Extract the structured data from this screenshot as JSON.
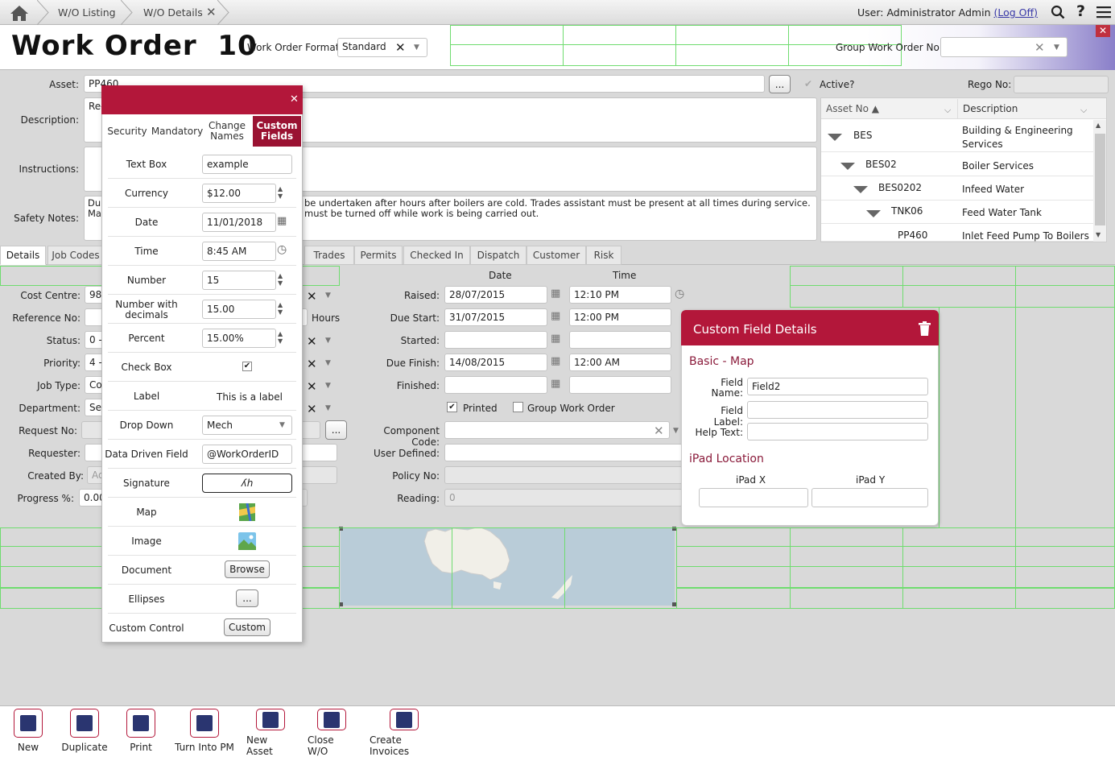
{
  "breadcrumbs": [
    "W/O Listing",
    "W/O Details"
  ],
  "user": {
    "prefix": "User: Administrator Admin",
    "logoff": "(Log Off)"
  },
  "title": "Work Order  10",
  "format": {
    "label": "Work Order Format",
    "value": "Standard"
  },
  "group_wo": {
    "label": "Group Work Order No:",
    "value": ""
  },
  "asset": {
    "label": "Asset:",
    "value": "PP460",
    "active_label": "Active?",
    "rego_label": "Rego No:"
  },
  "description": {
    "label": "Description:",
    "value": "Re-"
  },
  "instructions": {
    "label": "Instructions:"
  },
  "safety": {
    "label": "Safety Notes:",
    "line1a": "Du",
    "line2a": "Ma",
    "line1b": "be undertaken after hours after boilers are cold.  Trades assistant must be present at all times during service.",
    "line2b": "must be turned off while work is being carried out."
  },
  "tree": {
    "col1": "Asset No ▲",
    "col2": "Description",
    "rows": [
      {
        "no": "BES",
        "desc": "Building & Engineering Services"
      },
      {
        "no": "BES02",
        "desc": "Boiler Services"
      },
      {
        "no": "BES0202",
        "desc": "Infeed Water"
      },
      {
        "no": "TNK06",
        "desc": "Feed Water Tank"
      },
      {
        "no": "PP460",
        "desc": "Inlet Feed Pump To Boilers"
      }
    ]
  },
  "tabs": [
    "Details",
    "Job Codes",
    "Trades",
    "Permits",
    "Checked In",
    "Dispatch",
    "Customer",
    "Risk"
  ],
  "left_fields": [
    {
      "label": "Cost Centre:",
      "value": "98"
    },
    {
      "label": "Reference No:",
      "value": ""
    },
    {
      "label": "Status:",
      "value": "0 -"
    },
    {
      "label": "Priority:",
      "value": "4 -"
    },
    {
      "label": "Job Type:",
      "value": "Co"
    },
    {
      "label": "Department:",
      "value": "Se"
    },
    {
      "label": "Request No:",
      "value": ""
    },
    {
      "label": "Requester:",
      "value": ""
    },
    {
      "label": "Created By:",
      "value": "Ad"
    },
    {
      "label": "Progress %:",
      "value": "0.00"
    }
  ],
  "hours_label": "Hours",
  "dates": {
    "date_header": "Date",
    "time_header": "Time",
    "rows": [
      {
        "label": "Raised:",
        "date": "28/07/2015",
        "time": "12:10 PM"
      },
      {
        "label": "Due Start:",
        "date": "31/07/2015",
        "time": "12:00 PM"
      },
      {
        "label": "Started:",
        "date": "",
        "time": ""
      },
      {
        "label": "Due Finish:",
        "date": "14/08/2015",
        "time": "12:00 AM"
      },
      {
        "label": "Finished:",
        "date": "",
        "time": ""
      }
    ]
  },
  "printed_label": "Printed",
  "group_wo_label": "Group Work Order",
  "component_code": "Component Code:",
  "user_defined": "User Defined:",
  "policy_no": "Policy No:",
  "reading": {
    "label": "Reading:",
    "value": "0"
  },
  "popup": {
    "tabs": [
      "Security",
      "Mandatory",
      "Change Names",
      "Custom Fields"
    ],
    "rows": [
      {
        "label": "Text Box",
        "value": "example"
      },
      {
        "label": "Currency",
        "value": "$12.00"
      },
      {
        "label": "Date",
        "value": "11/01/2018"
      },
      {
        "label": "Time",
        "value": "8:45 AM"
      },
      {
        "label": "Number",
        "value": "15"
      },
      {
        "label": "Number with decimals",
        "value": "15.00"
      },
      {
        "label": "Percent",
        "value": "15.00%"
      },
      {
        "label": "Check Box",
        "value": ""
      },
      {
        "label": "Label",
        "value": "This is a label"
      },
      {
        "label": "Drop Down",
        "value": "Mech"
      },
      {
        "label": "Data Driven Field",
        "value": "@WorkOrderID"
      },
      {
        "label": "Signature",
        "value": ""
      },
      {
        "label": "Map",
        "value": ""
      },
      {
        "label": "Image",
        "value": ""
      },
      {
        "label": "Document",
        "value": "Browse"
      },
      {
        "label": "Ellipses",
        "value": "..."
      },
      {
        "label": "Custom Control",
        "value": "Custom"
      }
    ]
  },
  "cfd": {
    "title": "Custom Field Details",
    "section1": "Basic - Map",
    "field_name_label": "Field Name:",
    "field_name": "Field2",
    "field_label_label": "Field Label:",
    "help_text_label": "Help Text:",
    "section2": "iPad Location",
    "ipad_x": "iPad X",
    "ipad_y": "iPad Y"
  },
  "footer": [
    "New",
    "Duplicate",
    "Print",
    "Turn Into PM",
    "New Asset",
    "Close W/O",
    "Create Invoices"
  ],
  "colors": {
    "accent": "#b3173a",
    "grid": "#6fdc6f"
  }
}
